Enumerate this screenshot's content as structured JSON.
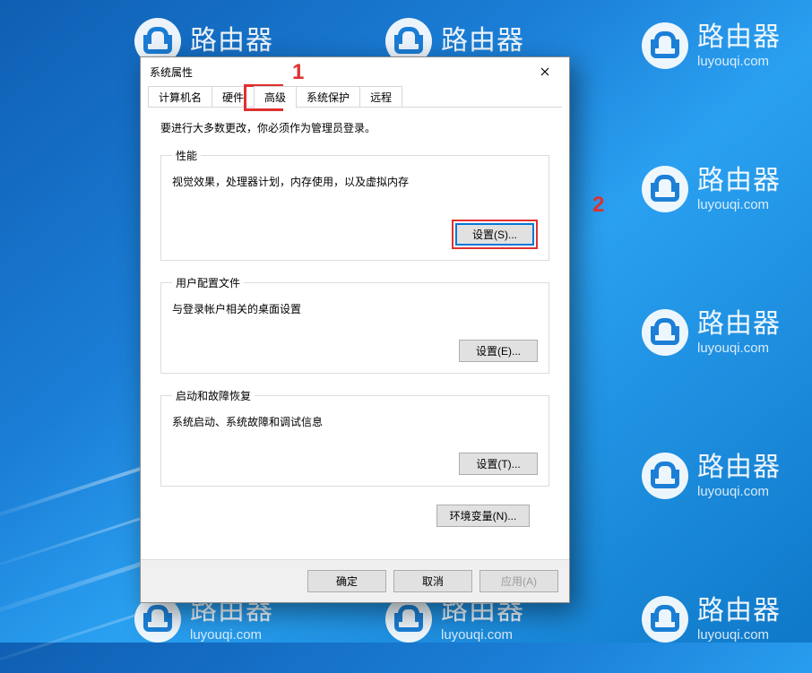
{
  "watermark": {
    "title": "路由器",
    "url": "luyouqi.com"
  },
  "markers": {
    "one": "1",
    "two": "2"
  },
  "dialog": {
    "title": "系统属性",
    "tabs": {
      "computer_name": "计算机名",
      "hardware": "硬件",
      "advanced": "高级",
      "system_protection": "系统保护",
      "remote": "远程"
    },
    "admin_note": "要进行大多数更改，你必须作为管理员登录。",
    "performance": {
      "legend": "性能",
      "desc": "视觉效果，处理器计划，内存使用，以及虚拟内存",
      "button": "设置(S)..."
    },
    "user_profiles": {
      "legend": "用户配置文件",
      "desc": "与登录帐户相关的桌面设置",
      "button": "设置(E)..."
    },
    "startup_recovery": {
      "legend": "启动和故障恢复",
      "desc": "系统启动、系统故障和调试信息",
      "button": "设置(T)..."
    },
    "env_vars_button": "环境变量(N)...",
    "footer": {
      "ok": "确定",
      "cancel": "取消",
      "apply": "应用(A)"
    }
  }
}
